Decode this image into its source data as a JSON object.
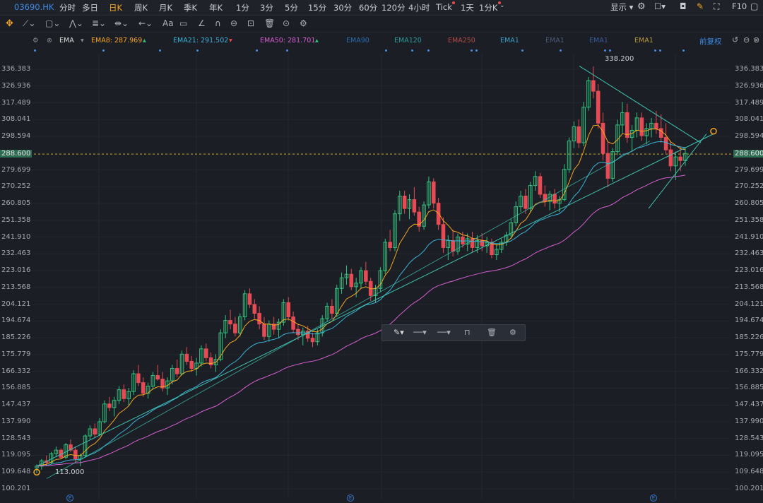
{
  "topbar": {
    "symbol": "03690.HK",
    "intervals": [
      "分时",
      "多日",
      "日K",
      "周K",
      "月K",
      "季K",
      "年K",
      "1分",
      "3分",
      "5分",
      "15分",
      "30分",
      "60分",
      "120分",
      "4小时",
      "Tick",
      "1天",
      "1分K"
    ],
    "active_interval": "日K",
    "display_label": "显示",
    "f10_label": "F10"
  },
  "indicators": {
    "name": "EMA",
    "items": [
      {
        "label": "EMA8: 287.969",
        "color": "#f5a623",
        "arrow": "up"
      },
      {
        "label": "EMA21: 291.502",
        "color": "#3bb3d8",
        "arrow": "down"
      },
      {
        "label": "EMA50: 281.701",
        "color": "#d45fd0",
        "arrow": "up"
      },
      {
        "label": "EMA90",
        "color": "#2b6cb0",
        "arrow": ""
      },
      {
        "label": "EMA120",
        "color": "#2c9c9c",
        "arrow": ""
      },
      {
        "label": "EMA250",
        "color": "#b84a4a",
        "arrow": ""
      },
      {
        "label": "EMA1",
        "color": "#3aa0c8",
        "arrow": ""
      },
      {
        "label": "EMA1",
        "color": "#4a5a7a",
        "arrow": ""
      },
      {
        "label": "EMA1",
        "color": "#3a5a9a",
        "arrow": ""
      },
      {
        "label": "EMA1",
        "color": "#b89a3a",
        "arrow": ""
      }
    ],
    "adjust_label": "前复权"
  },
  "price_axis": [
    "336.383",
    "326.936",
    "317.489",
    "308.041",
    "298.594",
    "289.147",
    "279.699",
    "270.252",
    "260.805",
    "251.358",
    "241.910",
    "232.463",
    "223.016",
    "213.568",
    "204.121",
    "194.674",
    "185.226",
    "175.779",
    "166.332",
    "156.885",
    "147.437",
    "137.990",
    "128.543",
    "119.095",
    "109.648",
    "100.201"
  ],
  "current_price": "288.600",
  "annotations": {
    "high": "338.200",
    "low": "113.000"
  },
  "event_marker": "E",
  "chart_data": {
    "type": "candlestick",
    "y_min": 100.201,
    "y_max": 336.383,
    "current": 288.6,
    "candles": [
      [
        112,
        114,
        109,
        113
      ],
      [
        113,
        117,
        111,
        116
      ],
      [
        116,
        119,
        113,
        115
      ],
      [
        115,
        121,
        114,
        120
      ],
      [
        120,
        124,
        118,
        122
      ],
      [
        122,
        123,
        117,
        118
      ],
      [
        118,
        126,
        117,
        125
      ],
      [
        125,
        128,
        121,
        122
      ],
      [
        122,
        124,
        115,
        117
      ],
      [
        117,
        120,
        113,
        119
      ],
      [
        119,
        131,
        118,
        130
      ],
      [
        130,
        136,
        128,
        134
      ],
      [
        134,
        137,
        129,
        131
      ],
      [
        131,
        140,
        130,
        138
      ],
      [
        138,
        150,
        137,
        148
      ],
      [
        148,
        152,
        144,
        146
      ],
      [
        146,
        152,
        141,
        150
      ],
      [
        150,
        158,
        148,
        156
      ],
      [
        156,
        159,
        149,
        151
      ],
      [
        151,
        157,
        147,
        155
      ],
      [
        155,
        167,
        153,
        165
      ],
      [
        165,
        170,
        158,
        160
      ],
      [
        160,
        163,
        152,
        154
      ],
      [
        154,
        160,
        151,
        158
      ],
      [
        158,
        166,
        156,
        164
      ],
      [
        164,
        170,
        161,
        162
      ],
      [
        162,
        166,
        155,
        157
      ],
      [
        157,
        163,
        153,
        161
      ],
      [
        161,
        170,
        159,
        168
      ],
      [
        168,
        173,
        163,
        165
      ],
      [
        165,
        178,
        164,
        176
      ],
      [
        176,
        180,
        170,
        172
      ],
      [
        172,
        175,
        166,
        168
      ],
      [
        168,
        174,
        164,
        171
      ],
      [
        171,
        181,
        169,
        179
      ],
      [
        179,
        182,
        172,
        174
      ],
      [
        174,
        177,
        168,
        170
      ],
      [
        170,
        176,
        166,
        173
      ],
      [
        173,
        190,
        172,
        188
      ],
      [
        188,
        198,
        185,
        195
      ],
      [
        195,
        201,
        190,
        193
      ],
      [
        193,
        197,
        186,
        188
      ],
      [
        188,
        199,
        186,
        197
      ],
      [
        197,
        212,
        195,
        210
      ],
      [
        210,
        213,
        202,
        204
      ],
      [
        204,
        207,
        196,
        199
      ],
      [
        199,
        203,
        190,
        193
      ],
      [
        193,
        197,
        184,
        186
      ],
      [
        186,
        195,
        183,
        193
      ],
      [
        193,
        197,
        187,
        190
      ],
      [
        190,
        196,
        185,
        194
      ],
      [
        194,
        207,
        192,
        205
      ],
      [
        205,
        208,
        195,
        197
      ],
      [
        197,
        200,
        188,
        190
      ],
      [
        190,
        193,
        184,
        187
      ],
      [
        187,
        191,
        181,
        189
      ],
      [
        189,
        192,
        183,
        185
      ],
      [
        185,
        188,
        180,
        183
      ],
      [
        183,
        190,
        181,
        188
      ],
      [
        188,
        198,
        186,
        196
      ],
      [
        196,
        205,
        194,
        203
      ],
      [
        203,
        207,
        196,
        199
      ],
      [
        199,
        215,
        197,
        213
      ],
      [
        213,
        222,
        210,
        219
      ],
      [
        219,
        226,
        215,
        221
      ],
      [
        221,
        224,
        212,
        214
      ],
      [
        214,
        219,
        208,
        216
      ],
      [
        216,
        225,
        213,
        223
      ],
      [
        223,
        228,
        215,
        217
      ],
      [
        217,
        219,
        206,
        209
      ],
      [
        209,
        215,
        205,
        213
      ],
      [
        213,
        225,
        211,
        223
      ],
      [
        223,
        241,
        221,
        239
      ],
      [
        239,
        246,
        234,
        236
      ],
      [
        236,
        257,
        234,
        255
      ],
      [
        255,
        268,
        251,
        265
      ],
      [
        265,
        268,
        255,
        258
      ],
      [
        258,
        266,
        252,
        263
      ],
      [
        263,
        270,
        254,
        256
      ],
      [
        256,
        259,
        245,
        248
      ],
      [
        248,
        262,
        246,
        260
      ],
      [
        260,
        276,
        258,
        273
      ],
      [
        273,
        275,
        258,
        261
      ],
      [
        261,
        264,
        246,
        249
      ],
      [
        249,
        253,
        233,
        236
      ],
      [
        236,
        243,
        229,
        240
      ],
      [
        240,
        246,
        231,
        234
      ],
      [
        234,
        244,
        232,
        242
      ],
      [
        242,
        245,
        236,
        238
      ],
      [
        238,
        244,
        234,
        241
      ],
      [
        241,
        245,
        233,
        236
      ],
      [
        236,
        243,
        233,
        240
      ],
      [
        240,
        244,
        234,
        237
      ],
      [
        237,
        242,
        233,
        239
      ],
      [
        239,
        241,
        230,
        232
      ],
      [
        232,
        238,
        229,
        235
      ],
      [
        235,
        241,
        233,
        239
      ],
      [
        239,
        245,
        237,
        243
      ],
      [
        243,
        252,
        241,
        250
      ],
      [
        250,
        262,
        248,
        259
      ],
      [
        259,
        268,
        256,
        265
      ],
      [
        265,
        269,
        255,
        258
      ],
      [
        258,
        273,
        256,
        271
      ],
      [
        271,
        279,
        268,
        276
      ],
      [
        276,
        278,
        264,
        266
      ],
      [
        266,
        271,
        259,
        262
      ],
      [
        262,
        268,
        257,
        266
      ],
      [
        266,
        269,
        258,
        261
      ],
      [
        261,
        265,
        256,
        263
      ],
      [
        263,
        283,
        262,
        280
      ],
      [
        280,
        298,
        278,
        296
      ],
      [
        296,
        307,
        292,
        304
      ],
      [
        304,
        308,
        292,
        295
      ],
      [
        295,
        318,
        293,
        315
      ],
      [
        315,
        332,
        313,
        330
      ],
      [
        330,
        338,
        320,
        324
      ],
      [
        324,
        328,
        303,
        306
      ],
      [
        306,
        312,
        285,
        289
      ],
      [
        289,
        296,
        270,
        275
      ],
      [
        275,
        292,
        273,
        290
      ],
      [
        290,
        308,
        288,
        305
      ],
      [
        305,
        318,
        300,
        312
      ],
      [
        312,
        317,
        295,
        298
      ],
      [
        298,
        305,
        290,
        302
      ],
      [
        302,
        312,
        298,
        309
      ],
      [
        309,
        312,
        296,
        299
      ],
      [
        299,
        306,
        294,
        303
      ],
      [
        303,
        309,
        298,
        306
      ],
      [
        306,
        313,
        300,
        303
      ],
      [
        303,
        311,
        295,
        298
      ],
      [
        298,
        306,
        289,
        291
      ],
      [
        291,
        296,
        279,
        282
      ],
      [
        282,
        290,
        274,
        287
      ],
      [
        287,
        293,
        279,
        285
      ],
      [
        285,
        292,
        282,
        289
      ]
    ]
  }
}
